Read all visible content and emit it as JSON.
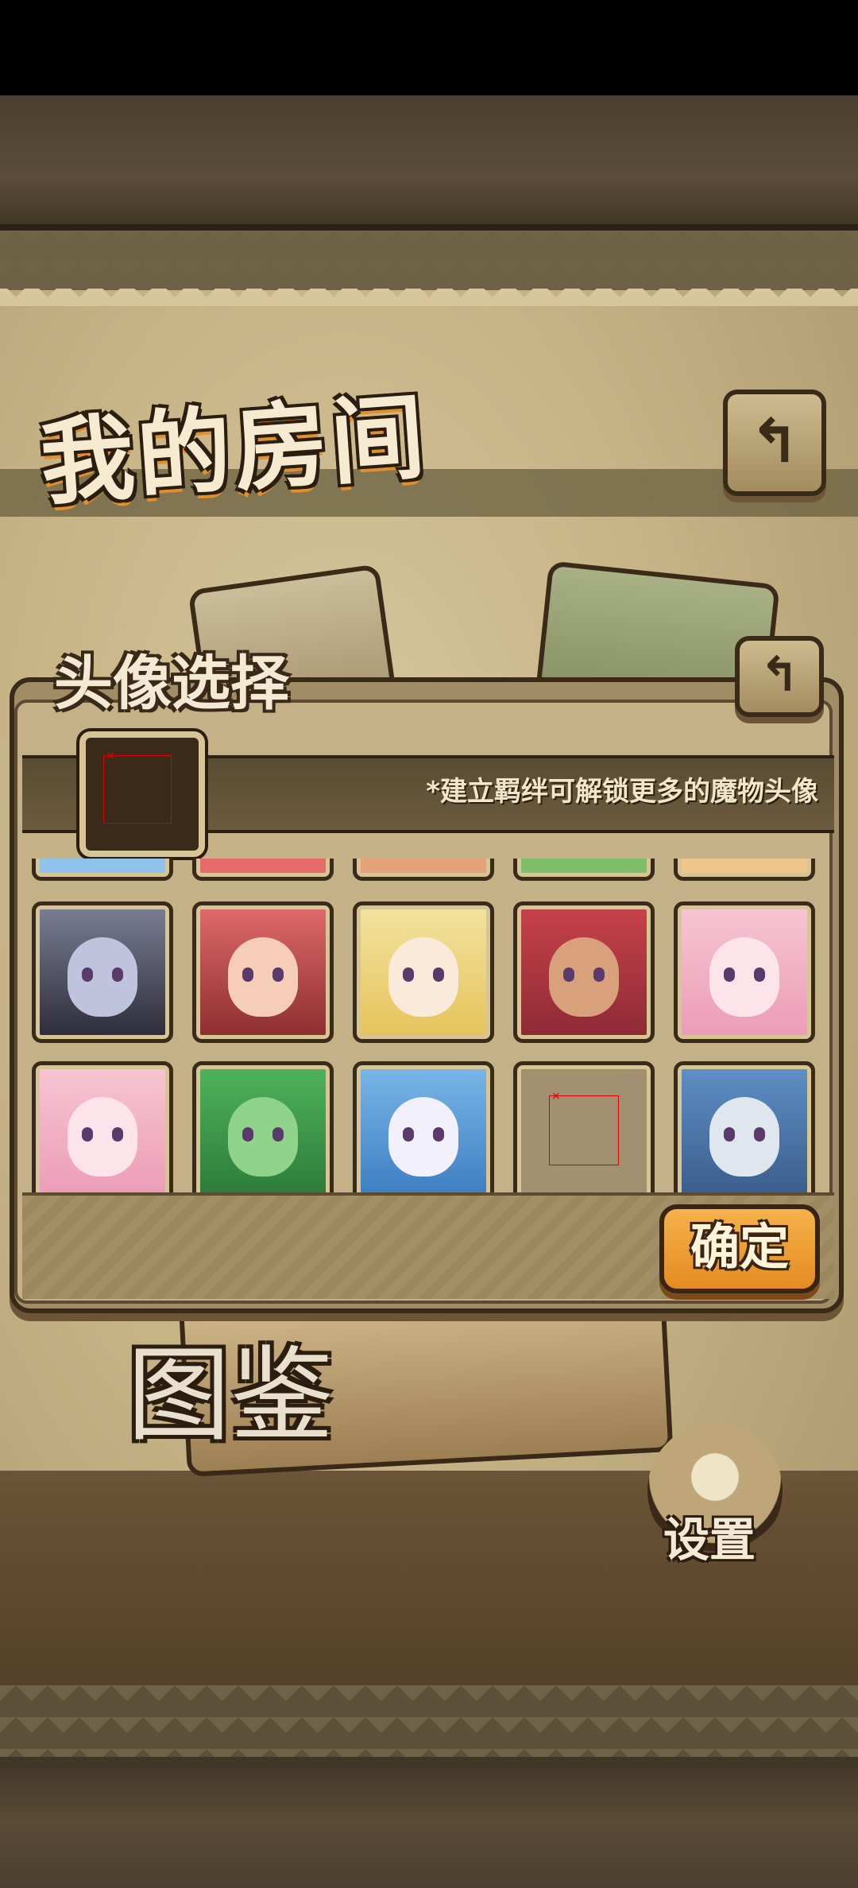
{
  "screen": {
    "title": "我的房间",
    "book_label": "图鉴",
    "settings_label": "设置",
    "back_icon_glyph": "↰"
  },
  "avatar_dialog": {
    "title": "头像选择",
    "hint": "*建立羁绊可解锁更多的魔物头像",
    "confirm_label": "确定",
    "rows": [
      [
        {
          "name": "avatar-dark-haired-horned-girl",
          "colors": [
            "#7b7f95",
            "#2c2b38",
            "#bfc3de"
          ]
        },
        {
          "name": "avatar-red-haired-girl-bow",
          "colors": [
            "#e06a6c",
            "#8b2d2f",
            "#f5cdb8"
          ]
        },
        {
          "name": "avatar-blonde-glasses-girl",
          "colors": [
            "#f2e3a0",
            "#e5c35a",
            "#fbe9da"
          ]
        },
        {
          "name": "avatar-red-haired-tan-girl",
          "colors": [
            "#c8424b",
            "#8c2a33",
            "#d9a07c"
          ]
        },
        {
          "name": "avatar-pink-haired-girl",
          "colors": [
            "#f7c6d3",
            "#eb9bb6",
            "#fde4ea"
          ]
        }
      ],
      [
        {
          "name": "avatar-pink-haired-girl-2",
          "colors": [
            "#f7c6d3",
            "#eb9bb6",
            "#fde4ea"
          ]
        },
        {
          "name": "avatar-green-slime-girl",
          "colors": [
            "#4fb45b",
            "#2c7a38",
            "#8fd48a"
          ]
        },
        {
          "name": "avatar-white-ghost-creature",
          "colors": [
            "#7ab7e8",
            "#3c7dc1",
            "#f1f0fb"
          ]
        },
        {
          "name": "avatar-locked",
          "colors": [
            "#a39070",
            "#a39070",
            "#a39070"
          ],
          "empty": true
        },
        {
          "name": "avatar-blue-haired-knight",
          "colors": [
            "#5f90c6",
            "#3a5c8a",
            "#dfe6ee"
          ]
        }
      ]
    ],
    "partial_row_colors": [
      "#8fc3ec",
      "#e66a6a",
      "#e5a27a",
      "#7fbf6a",
      "#efc58b"
    ]
  }
}
